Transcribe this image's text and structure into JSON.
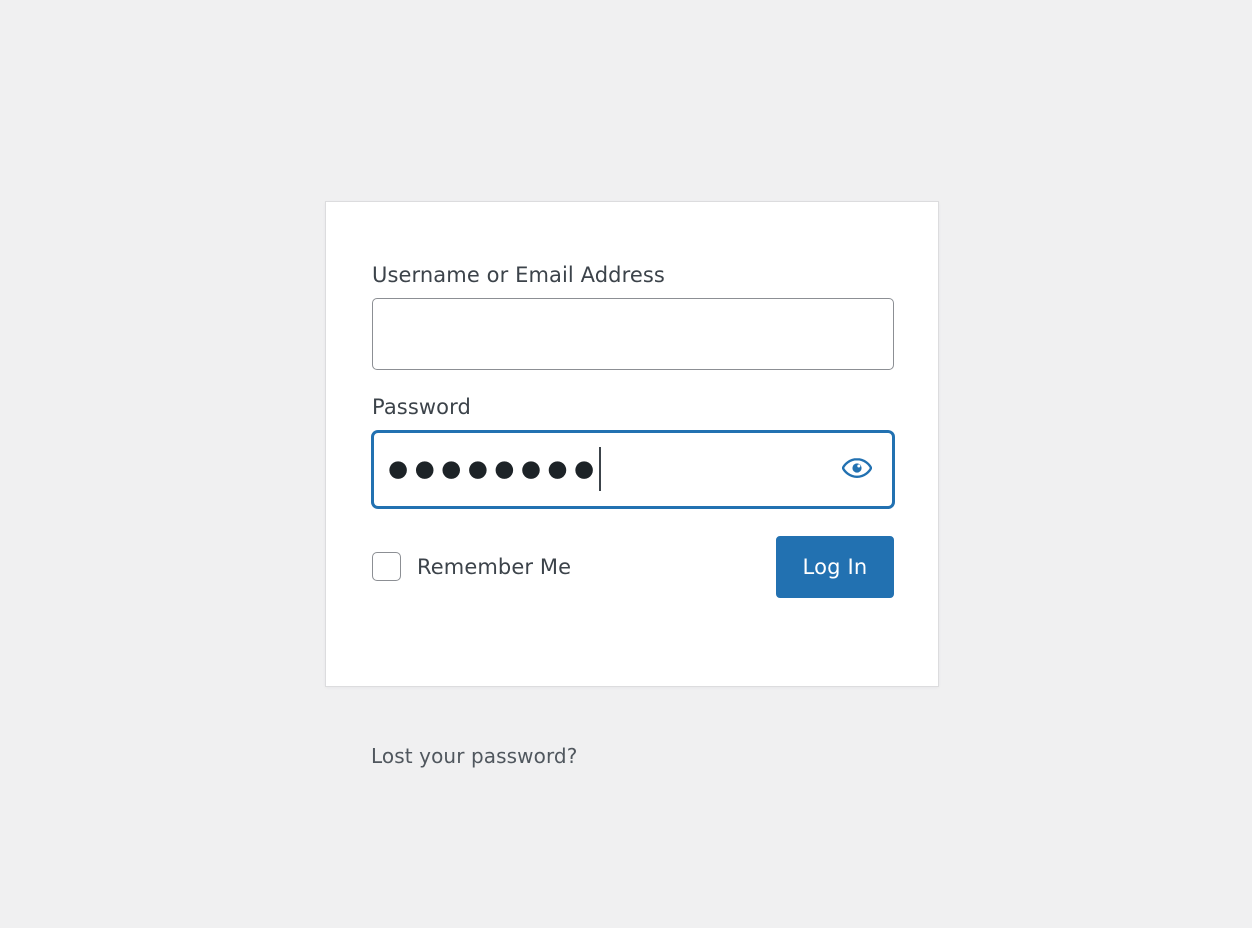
{
  "page": {
    "background_color": "#f0f0f1",
    "card_background": "#ffffff",
    "accent_color": "#2271b1",
    "label_color": "#3c434a",
    "border_color": "#8c8f94"
  },
  "form": {
    "username": {
      "label": "Username or Email Address",
      "value": "",
      "placeholder": ""
    },
    "password": {
      "label": "Password",
      "value": "●●●●●●●●",
      "placeholder": "",
      "character_count": 8,
      "focused": true,
      "toggle_icon": "eye-icon"
    },
    "remember_me": {
      "label": "Remember Me",
      "checked": false
    },
    "submit": {
      "label": "Log In"
    }
  },
  "links": {
    "lost_password": "Lost your password?"
  }
}
